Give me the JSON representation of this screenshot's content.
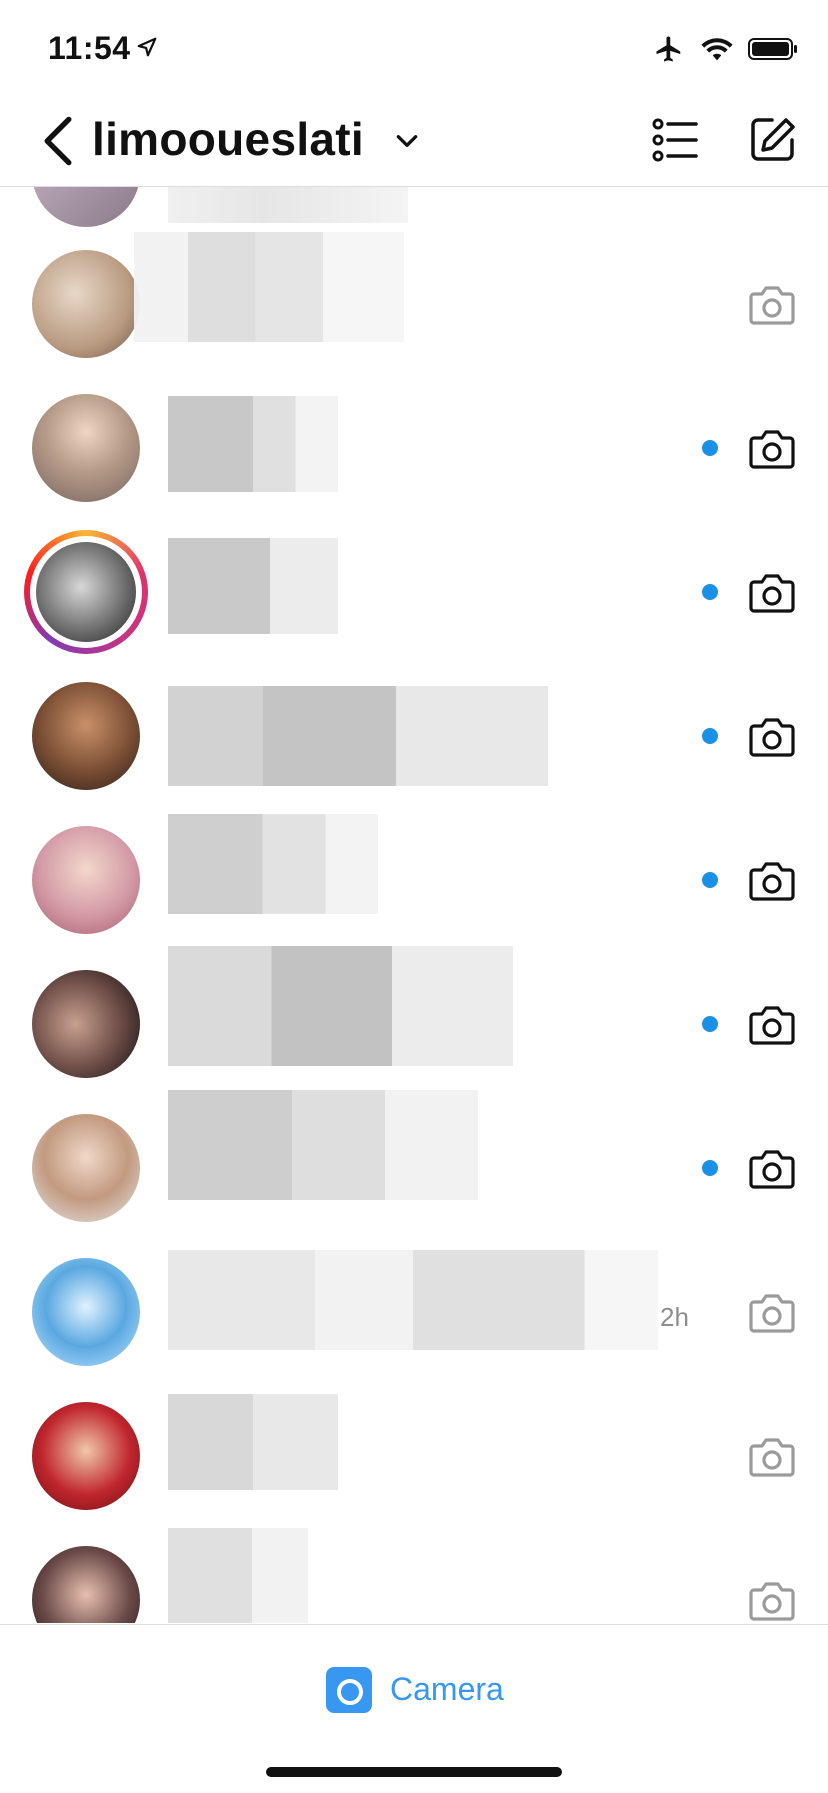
{
  "status_bar": {
    "time": "11:54"
  },
  "header": {
    "username": "limooueslati"
  },
  "threads": [
    {
      "time": "",
      "unread": false
    },
    {
      "time": "",
      "unread": false
    },
    {
      "time": "",
      "unread": true
    },
    {
      "time": "",
      "unread": true,
      "story_ring": true
    },
    {
      "time": "",
      "unread": true
    },
    {
      "time": "",
      "unread": true
    },
    {
      "time": "",
      "unread": true
    },
    {
      "time": "",
      "unread": true
    },
    {
      "time": "2h",
      "unread": false
    },
    {
      "time": "",
      "unread": false
    },
    {
      "time": "",
      "unread": false
    }
  ],
  "bottom_bar": {
    "camera_label": "Camera"
  },
  "colors": {
    "unread_dot": "#1a91e6",
    "accent": "#3897f0"
  }
}
